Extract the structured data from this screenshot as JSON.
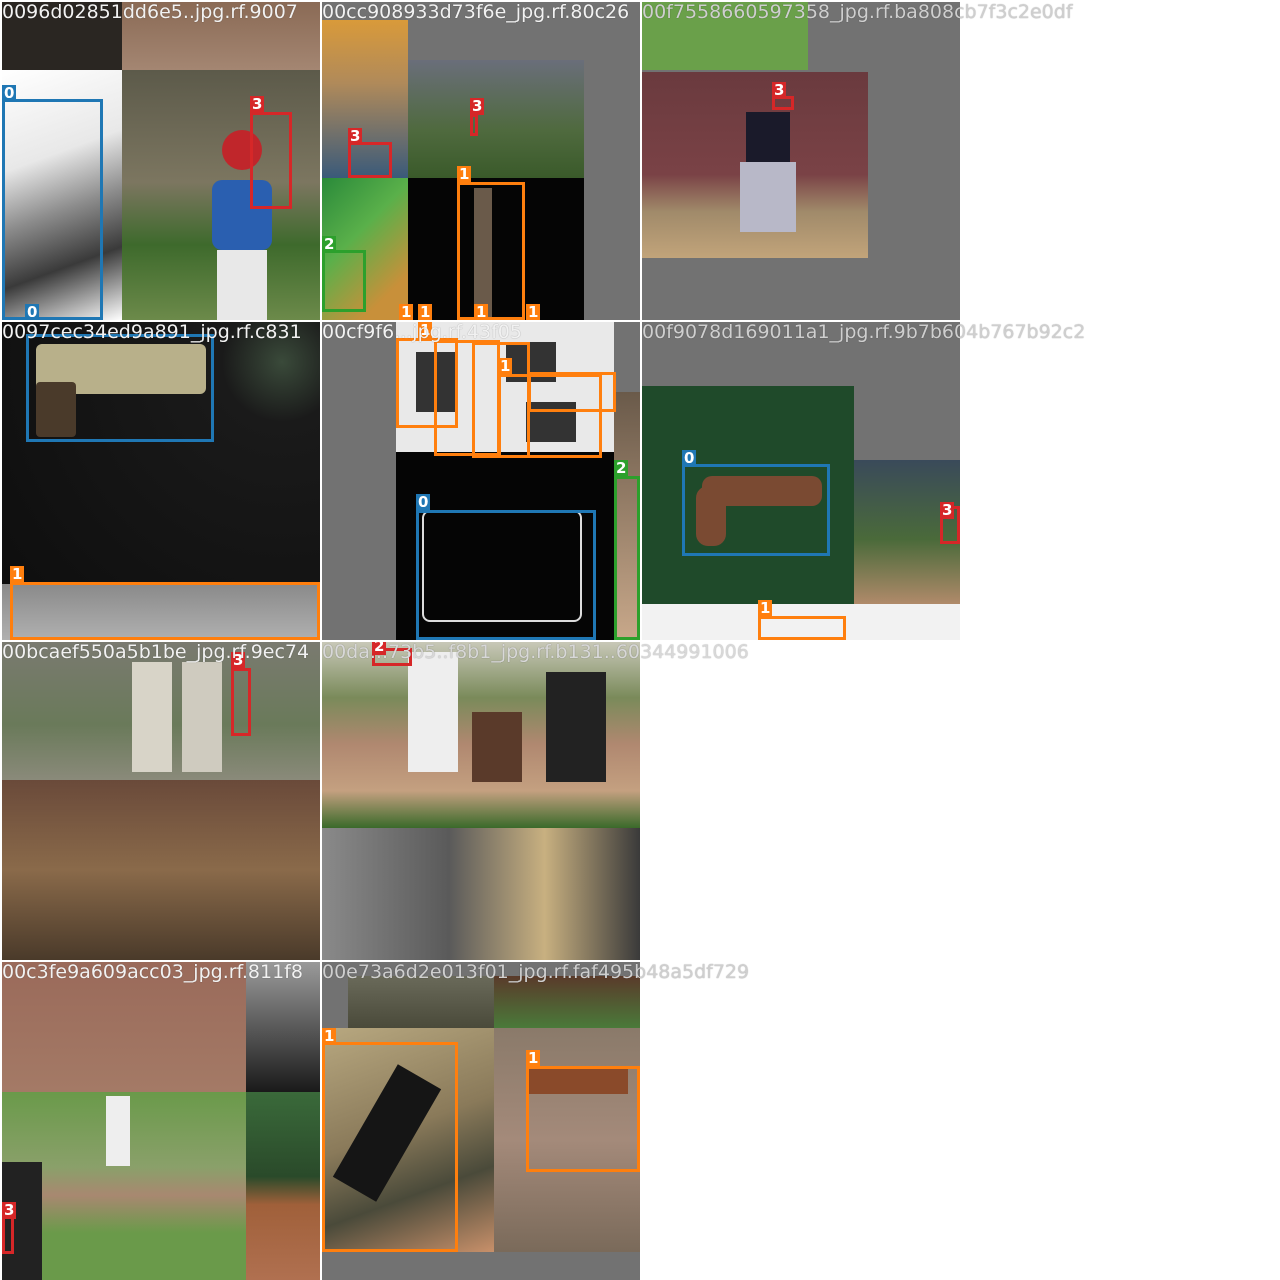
{
  "grid": {
    "tiles": [
      {
        "filename": "0096d02851dd6e5..jpg.rf.9007",
        "labels": [
          "0",
          "0",
          "3"
        ]
      },
      {
        "filename": "00cc908933d73f6e_jpg.rf.80c26",
        "labels": [
          "3",
          "3",
          "1",
          "2",
          "1",
          "1",
          "1",
          "1"
        ]
      },
      {
        "filename": "00f7558660597358_jpg.rf.ba808cb7f3c2e0df",
        "labels": [
          "3"
        ]
      },
      {
        "filename": "0097cec34ed9a891_jpg.rf.c831",
        "labels": [
          "0",
          "1"
        ]
      },
      {
        "filename": "00cf9f6...jpg.rf.43f05",
        "labels": [
          "1",
          "1",
          "1",
          "1",
          "0",
          "2"
        ]
      },
      {
        "filename": "00f9078d169011a1_jpg.rf.9b7b604b767b92c2",
        "labels": [
          "0",
          "3",
          "1"
        ]
      },
      {
        "filename": "00bcaef550a5b1be_jpg.rf.9ec74",
        "labels": [
          "3"
        ]
      },
      {
        "filename": "00da...73b5..f8b1_jpg.rf.b131..60344991006",
        "labels": [
          "2"
        ]
      },
      {
        "filename": "00c3fe9a609acc03_jpg.rf.811f8",
        "labels": [
          "3"
        ]
      },
      {
        "filename": "00e73a6d2e013f01_jpg.rf.faf495b48a5df729",
        "labels": [
          "1",
          "1"
        ]
      }
    ]
  },
  "classes": {
    "0": {
      "name": "0",
      "color": "#1f77b4"
    },
    "1": {
      "name": "1",
      "color": "#ff7f0e"
    },
    "2": {
      "name": "2",
      "color": "#2ca02c"
    },
    "3": {
      "name": "3",
      "color": "#d62728"
    }
  }
}
